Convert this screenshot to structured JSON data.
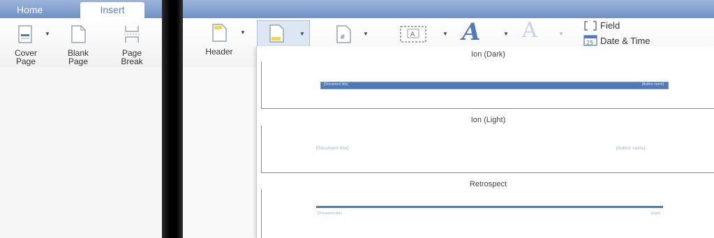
{
  "tabs": {
    "home": "Home",
    "insert": "Insert"
  },
  "ribbon_left": {
    "cover_page": [
      "Cover",
      "Page"
    ],
    "blank_page": [
      "Blank",
      "Page"
    ],
    "page_break": [
      "Page",
      "Break"
    ]
  },
  "ribbon_right": {
    "header": "Header",
    "field": "Field",
    "date_time": "Date & Time"
  },
  "gallery": {
    "items": [
      {
        "title": "Ion (Dark)",
        "left_text": "[Document title]",
        "right_text": "[Author name]"
      },
      {
        "title": "Ion (Light)",
        "left_text": "[Document title]",
        "right_text": "[Author name]"
      },
      {
        "title": "Retrospect",
        "left_text": "[Document title]",
        "right_text": "[Date]"
      }
    ]
  },
  "colors": {
    "accent": "#4f79b7",
    "tabbar": "#7e9ccc",
    "text": "#333333"
  }
}
